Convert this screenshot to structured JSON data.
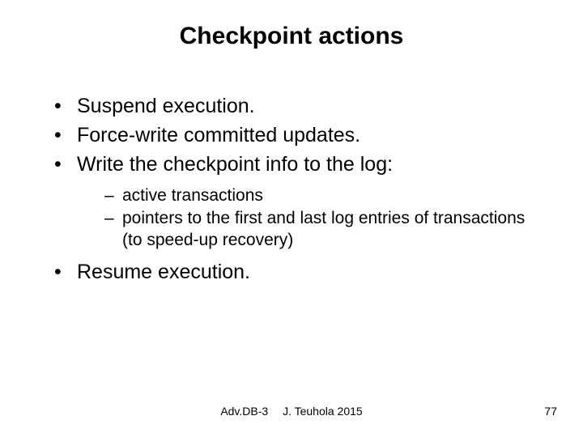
{
  "title": "Checkpoint actions",
  "bullets": {
    "b0": "Suspend execution.",
    "b1": "Force-write committed updates.",
    "b2": "Write the checkpoint info to the log:",
    "b3": "Resume execution."
  },
  "sub": {
    "s0": "active transactions",
    "s1": "pointers to the first and last log entries of transactions (to speed-up recovery)"
  },
  "footer": {
    "course": "Adv.DB-3",
    "author": "J. Teuhola 2015",
    "page": "77"
  }
}
